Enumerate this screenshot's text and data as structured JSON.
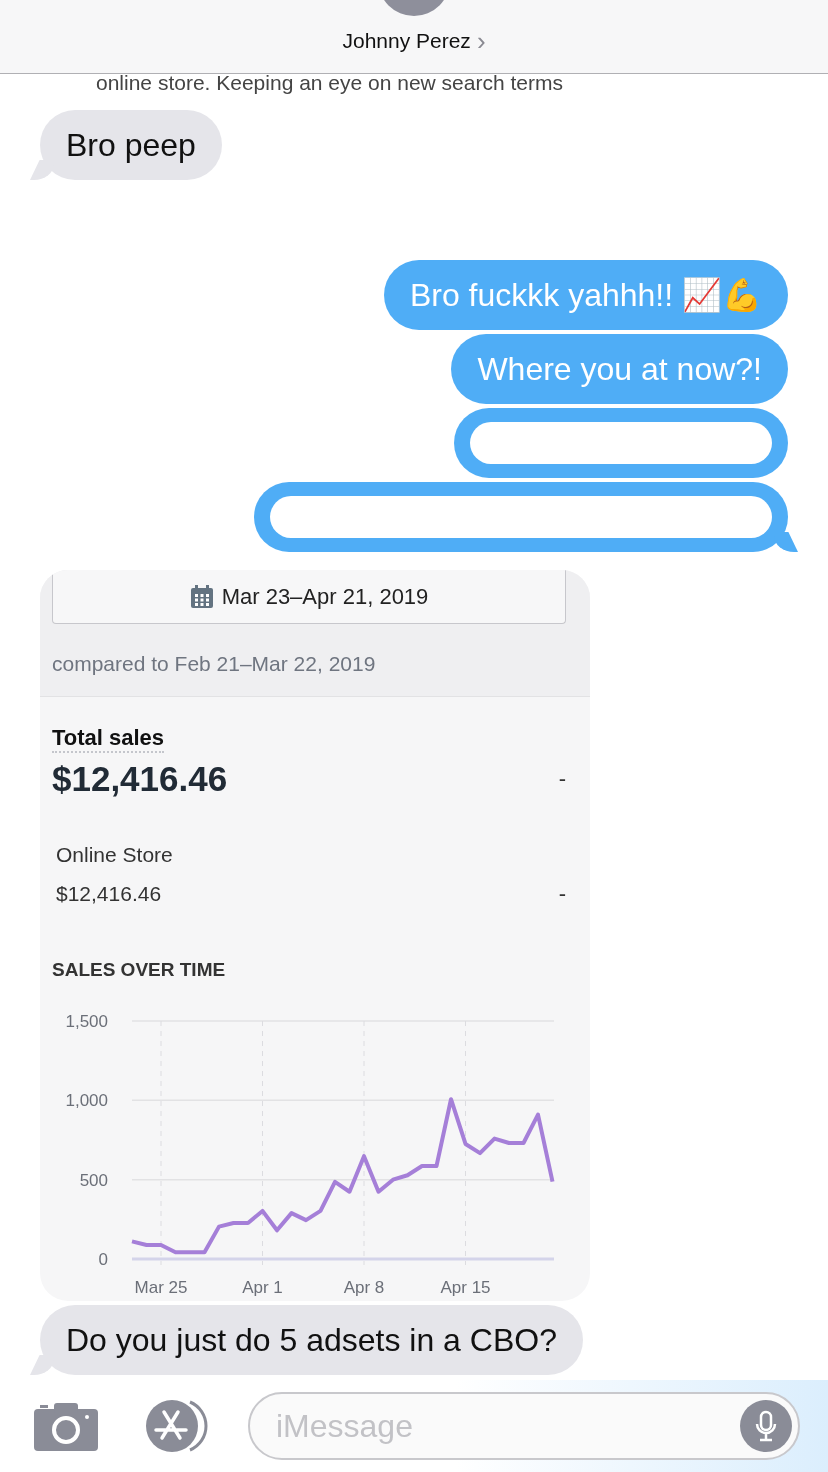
{
  "header": {
    "contact_name": "Johnny Perez",
    "chevron": "›"
  },
  "partial_message": "online store. Keeping an eye on new search terms",
  "thread": [
    {
      "kind": "text",
      "outgoing": false,
      "text": "Bro peep",
      "tail": true
    },
    {
      "kind": "text",
      "outgoing": true,
      "text": "Bro fuckkk yahhh!! 📈💪",
      "tail": false
    },
    {
      "kind": "text",
      "outgoing": true,
      "text": "Where you at now?!",
      "tail": false
    },
    {
      "kind": "redacted",
      "outgoing": true,
      "tail": false
    },
    {
      "kind": "redacted",
      "outgoing": true,
      "tail": true
    },
    {
      "kind": "card"
    },
    {
      "kind": "text",
      "outgoing": false,
      "text": "Do you just do 5 adsets in a CBO?",
      "tail": true
    }
  ],
  "card": {
    "date_range": "Mar 23–Apr 21, 2019",
    "comparison": "compared to Feb 21–Mar 22, 2019",
    "total_label": "Total sales",
    "total_value": "$12,416.46",
    "total_change": "-",
    "channel_label": "Online Store",
    "channel_value": "$12,416.46",
    "channel_change": "-",
    "chart_title": "SALES OVER TIME",
    "chart_data": {
      "type": "line",
      "grid": true,
      "categories": [
        null,
        null,
        "Mar 25",
        null,
        null,
        null,
        null,
        null,
        null,
        "Apr 1",
        null,
        null,
        null,
        null,
        null,
        null,
        "Apr 8",
        null,
        null,
        null,
        null,
        null,
        null,
        "Apr 15",
        null,
        null,
        null,
        null,
        null,
        null
      ],
      "series": [
        {
          "color": "#a57fd8",
          "values": [
            111,
            88,
            88,
            42,
            42,
            42,
            204,
            227,
            227,
            303,
            181,
            289,
            245,
            303,
            486,
            424,
            648,
            424,
            500,
            528,
            586,
            586,
            1007,
            725,
            667,
            759,
            731,
            731,
            910,
            488
          ]
        }
      ],
      "ylim": [
        0,
        1500
      ],
      "yticks": [
        0,
        500,
        {
          "value": 1000,
          "label": "1,000"
        },
        {
          "value": 1500,
          "label": "1,500"
        }
      ]
    }
  },
  "composer": {
    "placeholder": "iMessage"
  }
}
